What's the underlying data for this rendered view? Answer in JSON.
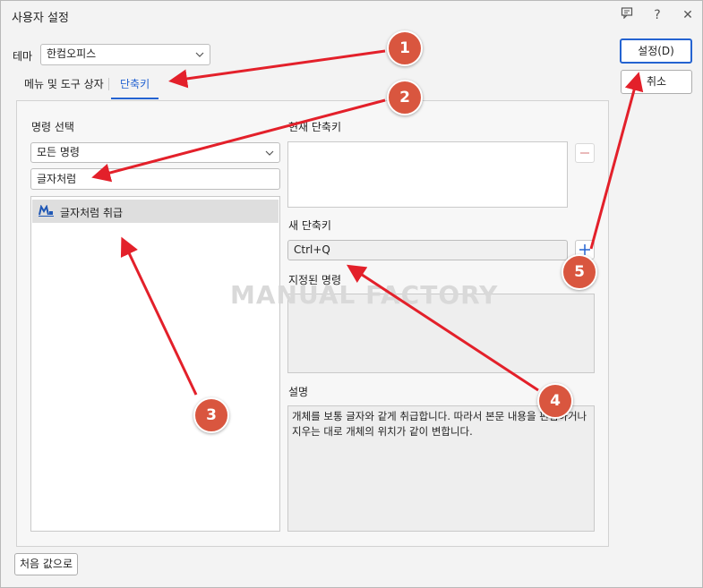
{
  "window": {
    "title": "사용자 설정",
    "icons": [
      "feedback-icon",
      "help-icon",
      "close-icon"
    ],
    "help_glyph": "?",
    "close_glyph": "✕"
  },
  "theme": {
    "label": "테마",
    "value": "한컴오피스"
  },
  "tabs": [
    {
      "label": "메뉴 및 도구 상자",
      "active": false
    },
    {
      "label": "단축키",
      "active": true
    }
  ],
  "command": {
    "section_label": "명령 선택",
    "category_value": "모든 명령",
    "search_value": "글자처럼",
    "results": [
      {
        "label": "글자처럼 취급",
        "icon": "treat-as-char-icon"
      }
    ]
  },
  "current_shortcut": {
    "label": "현재 단축키"
  },
  "new_shortcut": {
    "label": "새 단축키",
    "value": "Ctrl+Q"
  },
  "assigned": {
    "label": "지정된 명령"
  },
  "description": {
    "label": "설명",
    "text": "개체를 보통 글자와 같게 취급합니다. 따라서 본문 내용을 편집하거나 지우는 대로 개체의 위치가 같이 변합니다."
  },
  "buttons": {
    "ok": "설정(D)",
    "cancel": "취소",
    "reset": "처음 값으로"
  },
  "watermark": "MANUAL FACTORY",
  "annotations": [
    "1",
    "2",
    "3",
    "4",
    "5"
  ],
  "colors": {
    "accent": "#2463d1",
    "badge": "#d9563f",
    "arrow": "#e3202a"
  }
}
